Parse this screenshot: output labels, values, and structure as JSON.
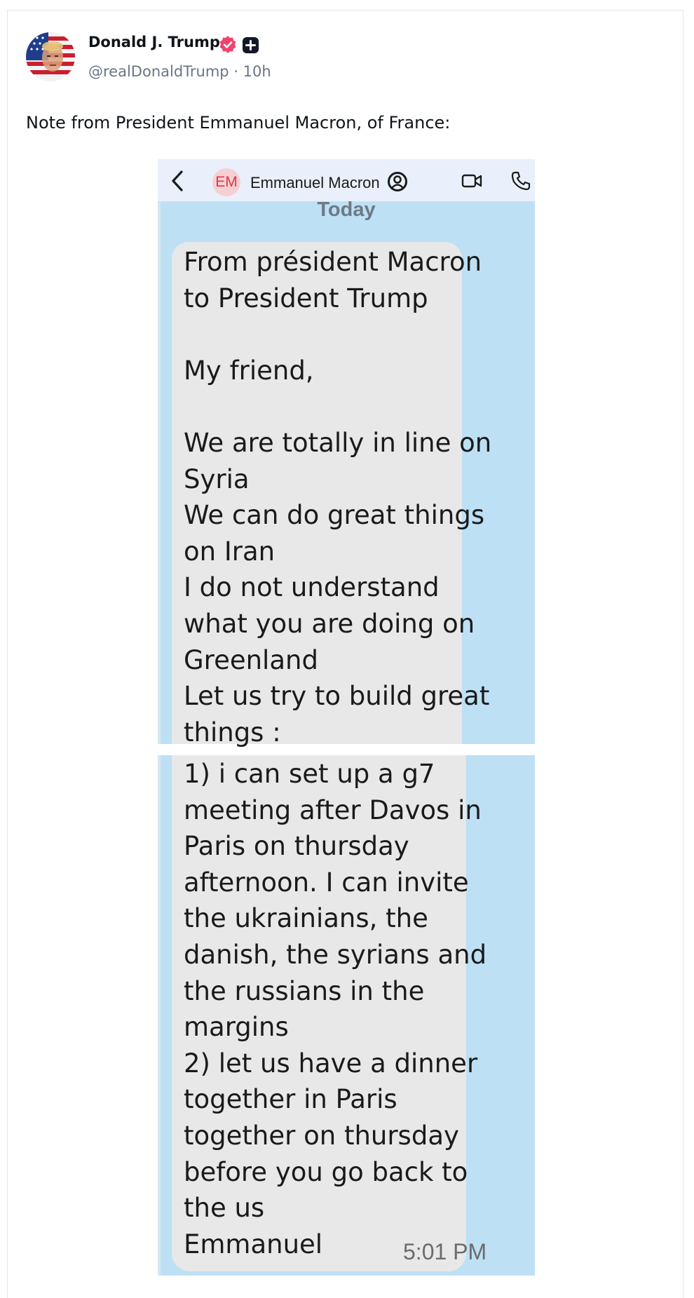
{
  "author": {
    "name": "Donald J. Trump",
    "handle": "@realDonaldTrump",
    "time_separator": " · ",
    "time_ago": "10h",
    "verified_icon": "verified-badge-icon",
    "badge_icon": "plus-badge-icon"
  },
  "post": {
    "text": "Note from President Emmanuel Macron, of France:"
  },
  "screenshot": {
    "header": {
      "contact_initials": "EM",
      "contact_name": "Emmanuel Macron"
    },
    "date_label": "Today",
    "message_part1": "From président Macron\nto President Trump\n\nMy friend,\n\nWe are totally in line on\nSyria\nWe can do great things\non Iran\nI do not understand\nwhat you are doing on\nGreenland\nLet us try to build great\nthings :",
    "message_part2": "1) i can set up a g7\nmeeting after Davos in\nParis on thursday\nafternoon. I can invite\nthe ukrainians, the\ndanish, the syrians and\nthe russians in the\nmargins\n2) let us have a dinner\ntogether in Paris\ntogether on thursday\nbefore you go back to\nthe us\nEmmanuel",
    "timestamp": "5:01 PM"
  },
  "colors": {
    "verified": "#f0426e",
    "chat_background": "#bde0f4",
    "bubble": "#e8e8e8",
    "handle_text": "#697586"
  }
}
